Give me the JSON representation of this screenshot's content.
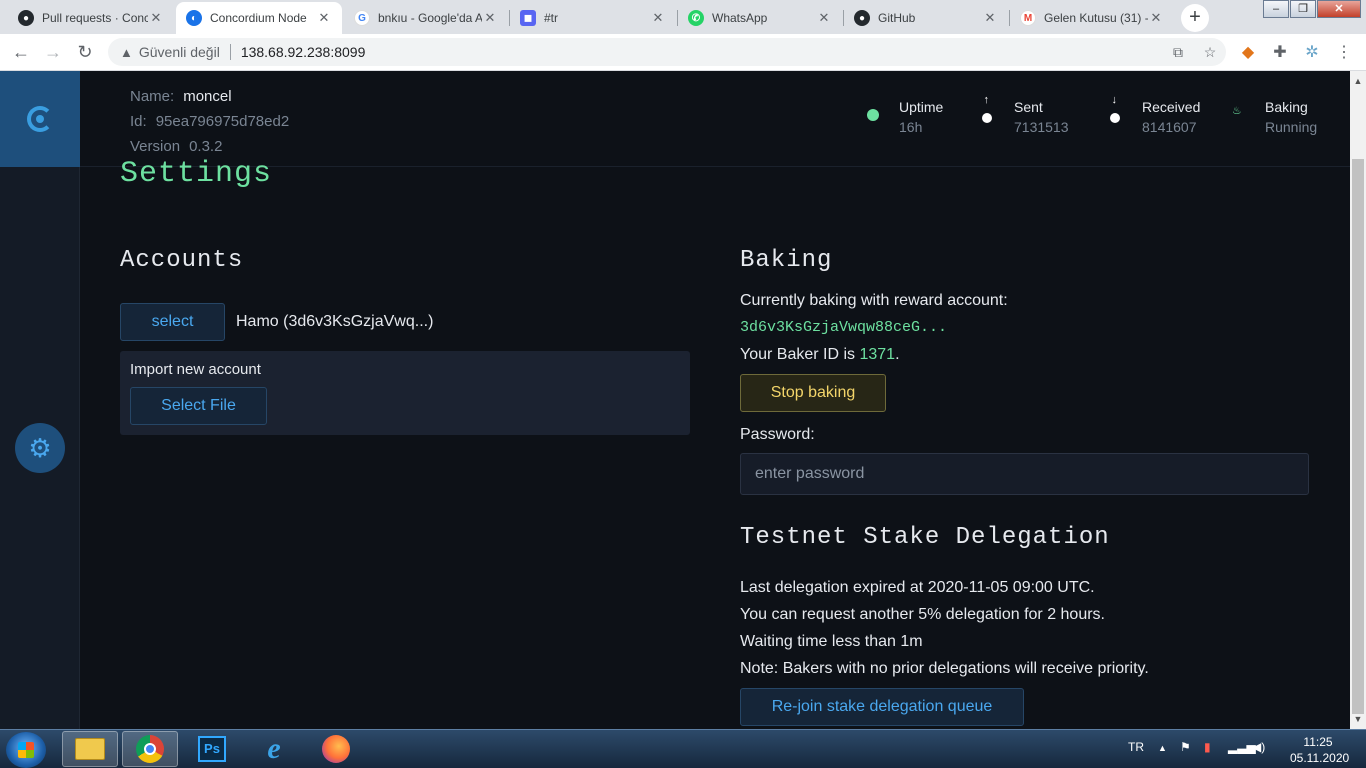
{
  "browser": {
    "tabs": [
      {
        "title": "Pull requests · Conc",
        "icon": "github-icon",
        "active": false
      },
      {
        "title": "Concordium Node",
        "icon": "concordium-icon",
        "active": true
      },
      {
        "title": "bnkıu - Google'da A",
        "icon": "google-icon",
        "active": false
      },
      {
        "title": "#tr",
        "icon": "discord-icon",
        "active": false
      },
      {
        "title": "WhatsApp",
        "icon": "whatsapp-icon",
        "active": false
      },
      {
        "title": "GitHub",
        "icon": "github-icon",
        "active": false
      },
      {
        "title": "Gelen Kutusu (31) -",
        "icon": "gmail-icon",
        "active": false
      }
    ],
    "address": {
      "security_label": "Güvenli değil",
      "url": "138.68.92.238:8099"
    }
  },
  "node": {
    "name_label": "Name:",
    "name": "moncel",
    "id_label": "Id:",
    "id": "95ea796975d78ed2",
    "version_label": "Version",
    "version": "0.3.2"
  },
  "stats": [
    {
      "label": "Uptime",
      "value": "16h",
      "icon": "status-dot-icon",
      "color": "#6de0a0"
    },
    {
      "label": "Sent",
      "value": "7131513",
      "icon": "arrow-up-icon",
      "color": "#ffffff"
    },
    {
      "label": "Received",
      "value": "8141607",
      "icon": "arrow-down-icon",
      "color": "#ffffff"
    },
    {
      "label": "Baking",
      "value": "Running",
      "icon": "baking-icon",
      "color": "#6de0a0"
    }
  ],
  "page": {
    "title": "Settings"
  },
  "accounts": {
    "title": "Accounts",
    "select_label": "select",
    "selected_account": "Hamo (3d6v3KsGzjaVwq...)",
    "import_label": "Import new account",
    "select_file_label": "Select File"
  },
  "baking": {
    "title": "Baking",
    "reward_text": "Currently baking with reward account:",
    "reward_account": "3d6v3KsGzjaVwqw88ceG...",
    "baker_id_prefix": "Your Baker ID is",
    "baker_id": "1371",
    "baker_id_suffix": ".",
    "stop_label": "Stop baking",
    "password_label": "Password:",
    "password_placeholder": "enter password"
  },
  "delegation": {
    "title": "Testnet Stake Delegation",
    "lines": [
      "Last delegation expired at 2020-11-05 09:00 UTC.",
      "You can request another 5% delegation for 2 hours.",
      "Waiting time less than 1m",
      "Note: Bakers with no prior delegations will receive priority."
    ],
    "rejoin_label": "Re-join stake delegation queue"
  },
  "taskbar": {
    "language": "TR",
    "time": "11:25",
    "date": "05.11.2020"
  },
  "colors": {
    "accent_green": "#6de0a0",
    "accent_blue": "#4aa8ef",
    "background": "#0d1117"
  }
}
